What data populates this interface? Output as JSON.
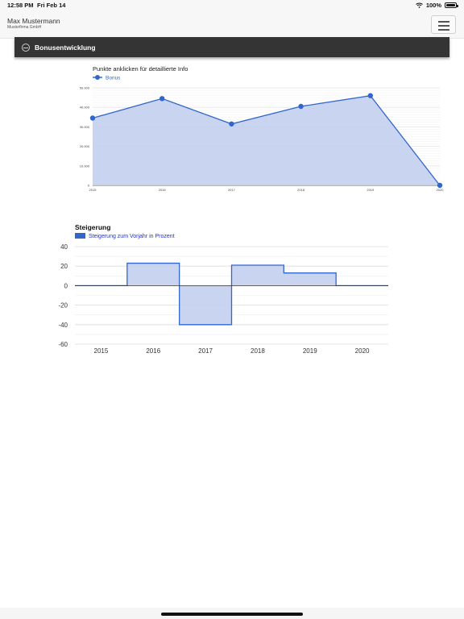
{
  "status": {
    "time": "12:58 PM",
    "date": "Fri Feb 14",
    "battery": "100%"
  },
  "header": {
    "user_name": "Max Mustermann",
    "company": "Musterfirma GmbH"
  },
  "section": {
    "title": "Bonusentwicklung"
  },
  "chart_data": [
    {
      "type": "area",
      "subtitle": "Punkte anklicken für detaillierte Info",
      "categories": [
        "2015",
        "2016",
        "2017",
        "2018",
        "2019",
        "2020"
      ],
      "series": [
        {
          "name": "Bonus",
          "values": [
            34500,
            44500,
            31500,
            40500,
            46000,
            0
          ]
        }
      ],
      "ylim": [
        0,
        50000
      ],
      "y_ticks": [
        "0",
        "10.000",
        "20.000",
        "30.000",
        "40.000",
        "50.000"
      ],
      "grid": true,
      "legend": "top-left",
      "colors": {
        "line": "#3366cc",
        "fill": "#c3cff0"
      }
    },
    {
      "type": "area",
      "title": "Steigerung",
      "categories": [
        "2015",
        "2016",
        "2017",
        "2018",
        "2019",
        "2020"
      ],
      "series": [
        {
          "name": "Steigerung zum Vorjahr in Prozent",
          "values": [
            0,
            23,
            -40,
            21,
            13,
            0
          ]
        }
      ],
      "ylim": [
        -60,
        40
      ],
      "y_ticks": [
        "-60",
        "-40",
        "-20",
        "0",
        "20",
        "40"
      ],
      "grid": true,
      "legend": "top-left",
      "colors": {
        "line": "#3366cc",
        "fill": "#c3cff0"
      }
    }
  ]
}
